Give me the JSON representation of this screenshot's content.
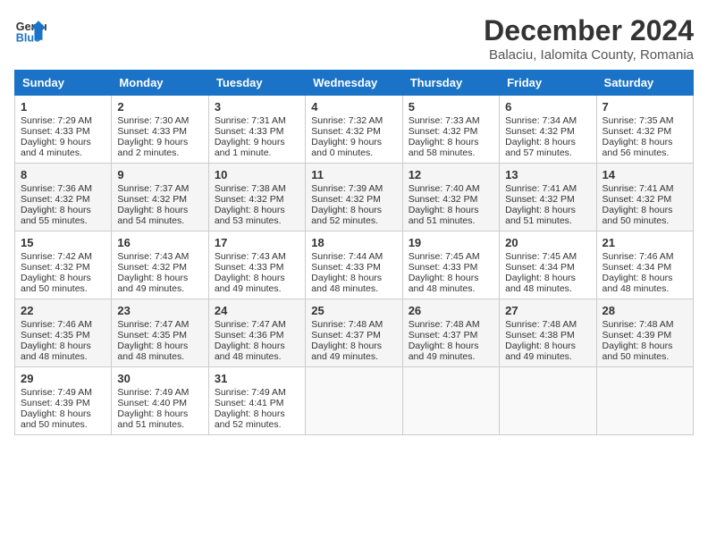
{
  "header": {
    "logo_line1": "General",
    "logo_line2": "Blue",
    "title": "December 2024",
    "subtitle": "Balaciu, Ialomita County, Romania"
  },
  "columns": [
    "Sunday",
    "Monday",
    "Tuesday",
    "Wednesday",
    "Thursday",
    "Friday",
    "Saturday"
  ],
  "weeks": [
    [
      {
        "day": "1",
        "sunrise": "Sunrise: 7:29 AM",
        "sunset": "Sunset: 4:33 PM",
        "daylight": "Daylight: 9 hours and 4 minutes."
      },
      {
        "day": "2",
        "sunrise": "Sunrise: 7:30 AM",
        "sunset": "Sunset: 4:33 PM",
        "daylight": "Daylight: 9 hours and 2 minutes."
      },
      {
        "day": "3",
        "sunrise": "Sunrise: 7:31 AM",
        "sunset": "Sunset: 4:33 PM",
        "daylight": "Daylight: 9 hours and 1 minute."
      },
      {
        "day": "4",
        "sunrise": "Sunrise: 7:32 AM",
        "sunset": "Sunset: 4:32 PM",
        "daylight": "Daylight: 9 hours and 0 minutes."
      },
      {
        "day": "5",
        "sunrise": "Sunrise: 7:33 AM",
        "sunset": "Sunset: 4:32 PM",
        "daylight": "Daylight: 8 hours and 58 minutes."
      },
      {
        "day": "6",
        "sunrise": "Sunrise: 7:34 AM",
        "sunset": "Sunset: 4:32 PM",
        "daylight": "Daylight: 8 hours and 57 minutes."
      },
      {
        "day": "7",
        "sunrise": "Sunrise: 7:35 AM",
        "sunset": "Sunset: 4:32 PM",
        "daylight": "Daylight: 8 hours and 56 minutes."
      }
    ],
    [
      {
        "day": "8",
        "sunrise": "Sunrise: 7:36 AM",
        "sunset": "Sunset: 4:32 PM",
        "daylight": "Daylight: 8 hours and 55 minutes."
      },
      {
        "day": "9",
        "sunrise": "Sunrise: 7:37 AM",
        "sunset": "Sunset: 4:32 PM",
        "daylight": "Daylight: 8 hours and 54 minutes."
      },
      {
        "day": "10",
        "sunrise": "Sunrise: 7:38 AM",
        "sunset": "Sunset: 4:32 PM",
        "daylight": "Daylight: 8 hours and 53 minutes."
      },
      {
        "day": "11",
        "sunrise": "Sunrise: 7:39 AM",
        "sunset": "Sunset: 4:32 PM",
        "daylight": "Daylight: 8 hours and 52 minutes."
      },
      {
        "day": "12",
        "sunrise": "Sunrise: 7:40 AM",
        "sunset": "Sunset: 4:32 PM",
        "daylight": "Daylight: 8 hours and 51 minutes."
      },
      {
        "day": "13",
        "sunrise": "Sunrise: 7:41 AM",
        "sunset": "Sunset: 4:32 PM",
        "daylight": "Daylight: 8 hours and 51 minutes."
      },
      {
        "day": "14",
        "sunrise": "Sunrise: 7:41 AM",
        "sunset": "Sunset: 4:32 PM",
        "daylight": "Daylight: 8 hours and 50 minutes."
      }
    ],
    [
      {
        "day": "15",
        "sunrise": "Sunrise: 7:42 AM",
        "sunset": "Sunset: 4:32 PM",
        "daylight": "Daylight: 8 hours and 50 minutes."
      },
      {
        "day": "16",
        "sunrise": "Sunrise: 7:43 AM",
        "sunset": "Sunset: 4:32 PM",
        "daylight": "Daylight: 8 hours and 49 minutes."
      },
      {
        "day": "17",
        "sunrise": "Sunrise: 7:43 AM",
        "sunset": "Sunset: 4:33 PM",
        "daylight": "Daylight: 8 hours and 49 minutes."
      },
      {
        "day": "18",
        "sunrise": "Sunrise: 7:44 AM",
        "sunset": "Sunset: 4:33 PM",
        "daylight": "Daylight: 8 hours and 48 minutes."
      },
      {
        "day": "19",
        "sunrise": "Sunrise: 7:45 AM",
        "sunset": "Sunset: 4:33 PM",
        "daylight": "Daylight: 8 hours and 48 minutes."
      },
      {
        "day": "20",
        "sunrise": "Sunrise: 7:45 AM",
        "sunset": "Sunset: 4:34 PM",
        "daylight": "Daylight: 8 hours and 48 minutes."
      },
      {
        "day": "21",
        "sunrise": "Sunrise: 7:46 AM",
        "sunset": "Sunset: 4:34 PM",
        "daylight": "Daylight: 8 hours and 48 minutes."
      }
    ],
    [
      {
        "day": "22",
        "sunrise": "Sunrise: 7:46 AM",
        "sunset": "Sunset: 4:35 PM",
        "daylight": "Daylight: 8 hours and 48 minutes."
      },
      {
        "day": "23",
        "sunrise": "Sunrise: 7:47 AM",
        "sunset": "Sunset: 4:35 PM",
        "daylight": "Daylight: 8 hours and 48 minutes."
      },
      {
        "day": "24",
        "sunrise": "Sunrise: 7:47 AM",
        "sunset": "Sunset: 4:36 PM",
        "daylight": "Daylight: 8 hours and 48 minutes."
      },
      {
        "day": "25",
        "sunrise": "Sunrise: 7:48 AM",
        "sunset": "Sunset: 4:37 PM",
        "daylight": "Daylight: 8 hours and 49 minutes."
      },
      {
        "day": "26",
        "sunrise": "Sunrise: 7:48 AM",
        "sunset": "Sunset: 4:37 PM",
        "daylight": "Daylight: 8 hours and 49 minutes."
      },
      {
        "day": "27",
        "sunrise": "Sunrise: 7:48 AM",
        "sunset": "Sunset: 4:38 PM",
        "daylight": "Daylight: 8 hours and 49 minutes."
      },
      {
        "day": "28",
        "sunrise": "Sunrise: 7:48 AM",
        "sunset": "Sunset: 4:39 PM",
        "daylight": "Daylight: 8 hours and 50 minutes."
      }
    ],
    [
      {
        "day": "29",
        "sunrise": "Sunrise: 7:49 AM",
        "sunset": "Sunset: 4:39 PM",
        "daylight": "Daylight: 8 hours and 50 minutes."
      },
      {
        "day": "30",
        "sunrise": "Sunrise: 7:49 AM",
        "sunset": "Sunset: 4:40 PM",
        "daylight": "Daylight: 8 hours and 51 minutes."
      },
      {
        "day": "31",
        "sunrise": "Sunrise: 7:49 AM",
        "sunset": "Sunset: 4:41 PM",
        "daylight": "Daylight: 8 hours and 52 minutes."
      },
      null,
      null,
      null,
      null
    ]
  ]
}
